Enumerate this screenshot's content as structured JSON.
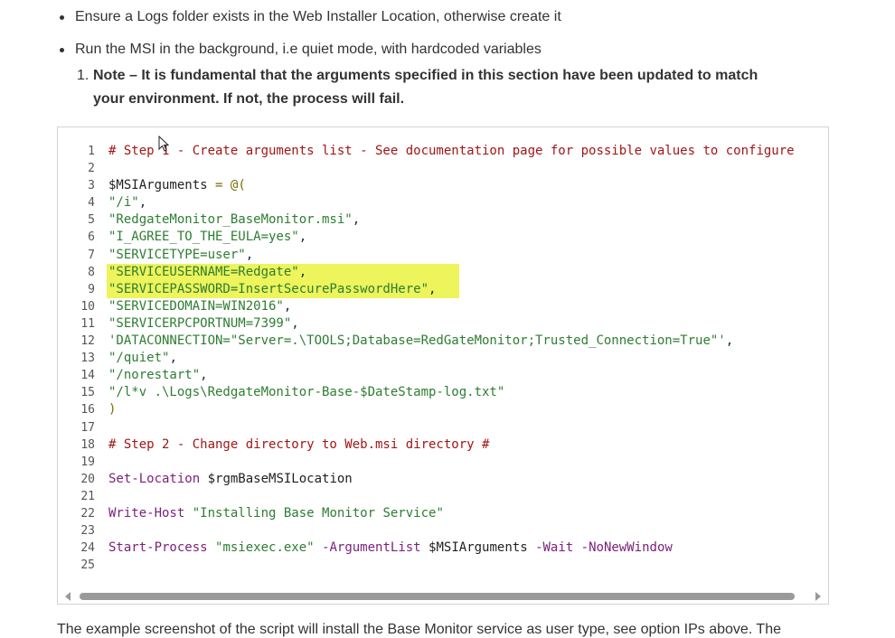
{
  "bullets": [
    "Ensure a Logs folder exists in the Web Installer Location, otherwise create it",
    "Run the MSI in the background, i.e quiet mode, with hardcoded variables"
  ],
  "note": {
    "number": "1.",
    "text": "Note – It is fundamental that the arguments specified in this section have been updated to match your environment. If not, the process will fail."
  },
  "code": {
    "line_numbers": [
      "1",
      "2",
      "3",
      "4",
      "5",
      "6",
      "7",
      "8",
      "9",
      "10",
      "11",
      "12",
      "13",
      "14",
      "15",
      "16",
      "17",
      "18",
      "19",
      "20",
      "21",
      "22",
      "23",
      "24",
      "25"
    ],
    "highlighted_lines": [
      8,
      9
    ],
    "lines": [
      "# Step 1 - Create arguments list - See documentation page for possible values to configure",
      "",
      "$MSIArguments = @(",
      "\"/i\",",
      "\"RedgateMonitor_BaseMonitor.msi\",",
      "\"I_AGREE_TO_THE_EULA=yes\",",
      "\"SERVICETYPE=user\",",
      "\"SERVICEUSERNAME=Redgate\",",
      "\"SERVICEPASSWORD=InsertSecurePasswordHere\",",
      "\"SERVICEDOMAIN=WIN2016\",",
      "\"SERVICERPCPORTNUM=7399\",",
      "'DATACONNECTION=\"Server=.\\TOOLS;Database=RedGateMonitor;Trusted_Connection=True\"',",
      "\"/quiet\",",
      "\"/norestart\",",
      "\"/l*v .\\Logs\\RedgateMonitor-Base-$DateStamp-log.txt\"",
      ")",
      "",
      "# Step 2 - Change directory to Web.msi directory #",
      "",
      "Set-Location $rgmBaseMSILocation",
      "",
      "Write-Host \"Installing Base Monitor Service\"",
      "",
      "Start-Process \"msiexec.exe\" -ArgumentList $MSIArguments -Wait -NoNewWindow",
      ""
    ]
  },
  "colors": {
    "highlight": "#edf45c",
    "comment": "#a31515",
    "string": "#2e7d32",
    "command": "#7b1f7b"
  },
  "bottom_text": "The example screenshot of the script will install the Base Monitor service as user type, see option IPs above. The"
}
